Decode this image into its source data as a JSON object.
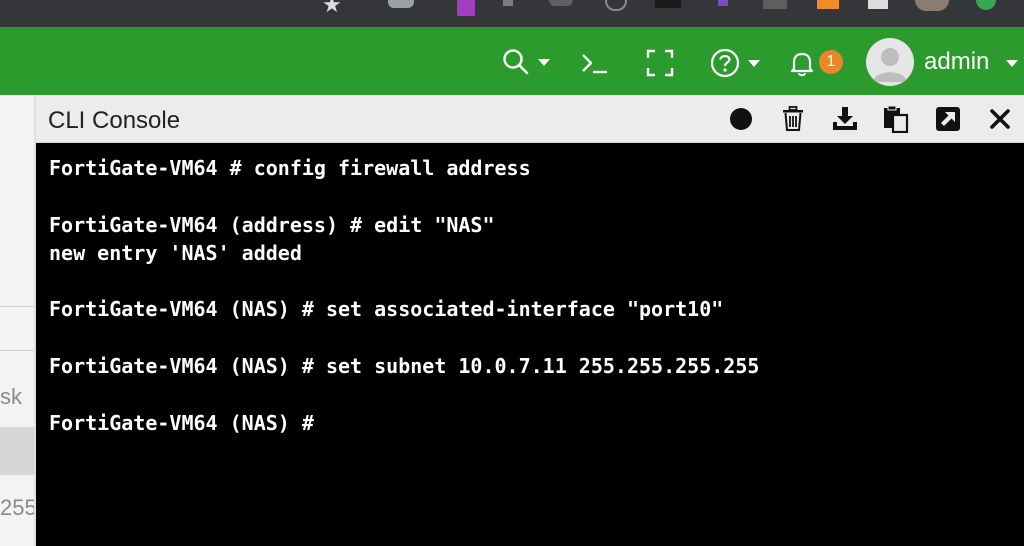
{
  "browser": {
    "extensions": [
      "bookmark-star-icon",
      "extension-icon",
      "extension-icon",
      "extension-icon",
      "extension-icon",
      "extension-icon",
      "extension-icon",
      "extension-icon",
      "extension-icon",
      "extension-icon",
      "extension-icon",
      "profile-icon"
    ]
  },
  "header": {
    "icons": [
      "search-icon",
      "cli-prompt-icon",
      "fullscreen-icon",
      "help-icon",
      "bell-icon"
    ],
    "notification_count": "1",
    "username": "admin",
    "colors": {
      "header_bg": "#2c9b2e",
      "badge": "#e8862b"
    }
  },
  "background_page": {
    "fragments": [
      "sk",
      "255"
    ]
  },
  "console": {
    "title": "CLI Console",
    "toolbar": [
      "record-icon",
      "trash-icon",
      "download-icon",
      "clipboard-icon",
      "detach-icon",
      "close-icon"
    ],
    "lines": [
      "FortiGate-VM64 # config firewall address",
      "FortiGate-VM64 (address) # edit \"NAS\"",
      "new entry 'NAS' added",
      "FortiGate-VM64 (NAS) # set associated-interface \"port10\"",
      "FortiGate-VM64 (NAS) # set subnet 10.0.7.11 255.255.255.255",
      "FortiGate-VM64 (NAS) #"
    ]
  }
}
